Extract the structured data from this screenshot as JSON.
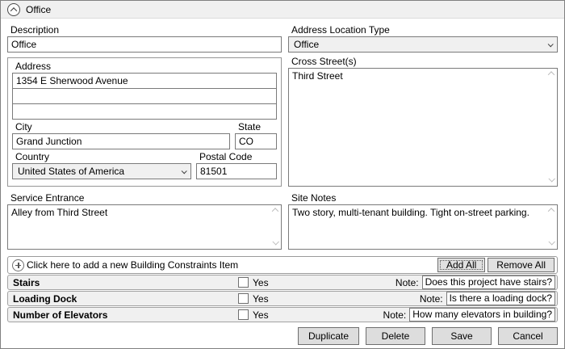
{
  "header": {
    "title": "Office"
  },
  "icons": {
    "header_collapse": "chevron-up-circle",
    "dropdown": "chevron-down",
    "scrollbar_up": "chevron-up",
    "scrollbar_down": "chevron-down",
    "add_item": "plus-circle"
  },
  "left": {
    "description": {
      "label": "Description",
      "value": "Office"
    },
    "address_group": {
      "label": "Address",
      "line1": "1354 E Sherwood Avenue",
      "line2": "",
      "line3": "",
      "city": {
        "label": "City",
        "value": "Grand Junction"
      },
      "state": {
        "label": "State",
        "value": "CO"
      },
      "country": {
        "label": "Country",
        "value": "United States of America"
      },
      "postal_code": {
        "label": "Postal Code",
        "value": "81501"
      }
    },
    "service_entrance": {
      "label": "Service Entrance",
      "value": "Alley from Third Street"
    }
  },
  "right": {
    "location_type": {
      "label": "Address Location Type",
      "value": "Office"
    },
    "cross_streets": {
      "label": "Cross Street(s)",
      "value": "Third Street"
    },
    "site_notes": {
      "label": "Site Notes",
      "value": "Two story, multi-tenant building. Tight on-street parking."
    }
  },
  "constraints": {
    "add_prompt": "Click here to add a new Building Constraints Item",
    "add_all_label": "Add All",
    "remove_all_label": "Remove All",
    "yes_label": "Yes",
    "note_label": "Note:",
    "rows": [
      {
        "name": "Stairs",
        "checked": false,
        "note": "Does this project have stairs?"
      },
      {
        "name": "Loading Dock",
        "checked": false,
        "note": "Is there a loading dock?"
      },
      {
        "name": "Number of Elevators",
        "checked": false,
        "note": "How many elevators in building?"
      }
    ]
  },
  "footer": {
    "buttons": [
      "Duplicate",
      "Delete",
      "Save",
      "Cancel"
    ]
  }
}
